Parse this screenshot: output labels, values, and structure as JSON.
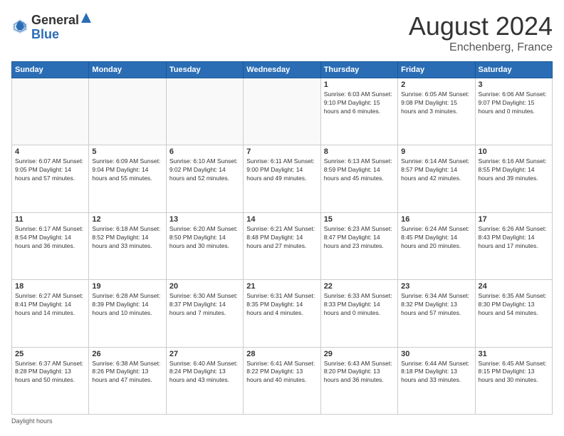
{
  "header": {
    "logo_general": "General",
    "logo_blue": "Blue",
    "month": "August 2024",
    "location": "Enchenberg, France"
  },
  "footer": {
    "label": "Daylight hours"
  },
  "weekdays": [
    "Sunday",
    "Monday",
    "Tuesday",
    "Wednesday",
    "Thursday",
    "Friday",
    "Saturday"
  ],
  "weeks": [
    [
      {
        "day": "",
        "info": ""
      },
      {
        "day": "",
        "info": ""
      },
      {
        "day": "",
        "info": ""
      },
      {
        "day": "",
        "info": ""
      },
      {
        "day": "1",
        "info": "Sunrise: 6:03 AM\nSunset: 9:10 PM\nDaylight: 15 hours\nand 6 minutes."
      },
      {
        "day": "2",
        "info": "Sunrise: 6:05 AM\nSunset: 9:08 PM\nDaylight: 15 hours\nand 3 minutes."
      },
      {
        "day": "3",
        "info": "Sunrise: 6:06 AM\nSunset: 9:07 PM\nDaylight: 15 hours\nand 0 minutes."
      }
    ],
    [
      {
        "day": "4",
        "info": "Sunrise: 6:07 AM\nSunset: 9:05 PM\nDaylight: 14 hours\nand 57 minutes."
      },
      {
        "day": "5",
        "info": "Sunrise: 6:09 AM\nSunset: 9:04 PM\nDaylight: 14 hours\nand 55 minutes."
      },
      {
        "day": "6",
        "info": "Sunrise: 6:10 AM\nSunset: 9:02 PM\nDaylight: 14 hours\nand 52 minutes."
      },
      {
        "day": "7",
        "info": "Sunrise: 6:11 AM\nSunset: 9:00 PM\nDaylight: 14 hours\nand 49 minutes."
      },
      {
        "day": "8",
        "info": "Sunrise: 6:13 AM\nSunset: 8:59 PM\nDaylight: 14 hours\nand 45 minutes."
      },
      {
        "day": "9",
        "info": "Sunrise: 6:14 AM\nSunset: 8:57 PM\nDaylight: 14 hours\nand 42 minutes."
      },
      {
        "day": "10",
        "info": "Sunrise: 6:16 AM\nSunset: 8:55 PM\nDaylight: 14 hours\nand 39 minutes."
      }
    ],
    [
      {
        "day": "11",
        "info": "Sunrise: 6:17 AM\nSunset: 8:54 PM\nDaylight: 14 hours\nand 36 minutes."
      },
      {
        "day": "12",
        "info": "Sunrise: 6:18 AM\nSunset: 8:52 PM\nDaylight: 14 hours\nand 33 minutes."
      },
      {
        "day": "13",
        "info": "Sunrise: 6:20 AM\nSunset: 8:50 PM\nDaylight: 14 hours\nand 30 minutes."
      },
      {
        "day": "14",
        "info": "Sunrise: 6:21 AM\nSunset: 8:48 PM\nDaylight: 14 hours\nand 27 minutes."
      },
      {
        "day": "15",
        "info": "Sunrise: 6:23 AM\nSunset: 8:47 PM\nDaylight: 14 hours\nand 23 minutes."
      },
      {
        "day": "16",
        "info": "Sunrise: 6:24 AM\nSunset: 8:45 PM\nDaylight: 14 hours\nand 20 minutes."
      },
      {
        "day": "17",
        "info": "Sunrise: 6:26 AM\nSunset: 8:43 PM\nDaylight: 14 hours\nand 17 minutes."
      }
    ],
    [
      {
        "day": "18",
        "info": "Sunrise: 6:27 AM\nSunset: 8:41 PM\nDaylight: 14 hours\nand 14 minutes."
      },
      {
        "day": "19",
        "info": "Sunrise: 6:28 AM\nSunset: 8:39 PM\nDaylight: 14 hours\nand 10 minutes."
      },
      {
        "day": "20",
        "info": "Sunrise: 6:30 AM\nSunset: 8:37 PM\nDaylight: 14 hours\nand 7 minutes."
      },
      {
        "day": "21",
        "info": "Sunrise: 6:31 AM\nSunset: 8:35 PM\nDaylight: 14 hours\nand 4 minutes."
      },
      {
        "day": "22",
        "info": "Sunrise: 6:33 AM\nSunset: 8:33 PM\nDaylight: 14 hours\nand 0 minutes."
      },
      {
        "day": "23",
        "info": "Sunrise: 6:34 AM\nSunset: 8:32 PM\nDaylight: 13 hours\nand 57 minutes."
      },
      {
        "day": "24",
        "info": "Sunrise: 6:35 AM\nSunset: 8:30 PM\nDaylight: 13 hours\nand 54 minutes."
      }
    ],
    [
      {
        "day": "25",
        "info": "Sunrise: 6:37 AM\nSunset: 8:28 PM\nDaylight: 13 hours\nand 50 minutes."
      },
      {
        "day": "26",
        "info": "Sunrise: 6:38 AM\nSunset: 8:26 PM\nDaylight: 13 hours\nand 47 minutes."
      },
      {
        "day": "27",
        "info": "Sunrise: 6:40 AM\nSunset: 8:24 PM\nDaylight: 13 hours\nand 43 minutes."
      },
      {
        "day": "28",
        "info": "Sunrise: 6:41 AM\nSunset: 8:22 PM\nDaylight: 13 hours\nand 40 minutes."
      },
      {
        "day": "29",
        "info": "Sunrise: 6:43 AM\nSunset: 8:20 PM\nDaylight: 13 hours\nand 36 minutes."
      },
      {
        "day": "30",
        "info": "Sunrise: 6:44 AM\nSunset: 8:18 PM\nDaylight: 13 hours\nand 33 minutes."
      },
      {
        "day": "31",
        "info": "Sunrise: 6:45 AM\nSunset: 8:15 PM\nDaylight: 13 hours\nand 30 minutes."
      }
    ]
  ]
}
